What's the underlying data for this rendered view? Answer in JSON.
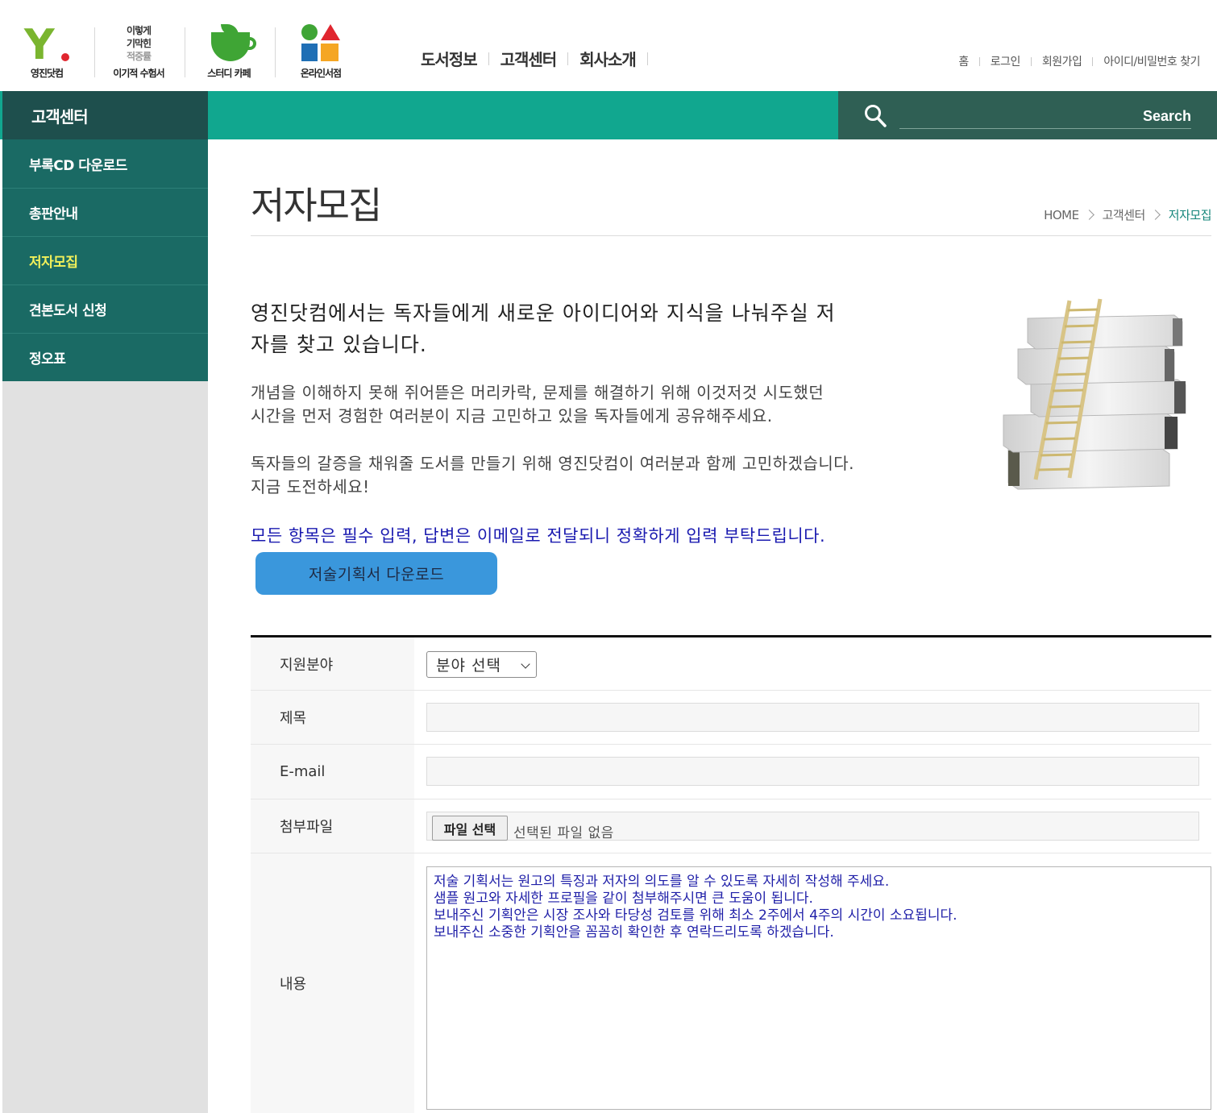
{
  "header": {
    "logos": [
      {
        "name": "영진닷컴"
      },
      {
        "name": "이기적 수험서",
        "stack": [
          "이렇게",
          "기막힌",
          "적중률"
        ]
      },
      {
        "name": "스터디 카페"
      },
      {
        "name": "온라인서점"
      }
    ],
    "gnb": [
      "도서정보",
      "고객센터",
      "회사소개"
    ],
    "util": [
      "홈",
      "로그인",
      "회원가입",
      "아이디/비밀번호 찾기"
    ]
  },
  "bar": {
    "side_title": "고객센터",
    "search_label": "Search",
    "colors": {
      "teal": "#11a78f",
      "side": "#1e4f4d",
      "search": "#2f5f54"
    }
  },
  "sidebar": {
    "items": [
      {
        "label": "부록CD 다운로드",
        "active": false
      },
      {
        "label": "총판안내",
        "active": false
      },
      {
        "label": "저자모집",
        "active": true
      },
      {
        "label": "견본도서 신청",
        "active": false
      },
      {
        "label": "정오표",
        "active": false
      }
    ]
  },
  "page": {
    "title": "저자모집",
    "breadcrumb": [
      "HOME",
      "고객센터",
      "저자모집"
    ],
    "intro_head_line1": "영진닷컴에서는 독자들에게 새로운 아이디어와 지식을 나눠주실 저",
    "intro_head_line2": "자를 찾고 있습니다.",
    "intro_p1_line1": "개념을 이해하지 못해 쥐어뜯은 머리카락, 문제를 해결하기 위해 이것저것 시도했던",
    "intro_p1_line2": "시간을 먼저 경험한 여러분이 지금 고민하고 있을 독자들에게 공유해주세요.",
    "intro_p2_line1": "독자들의 갈증을 채워줄 도서를 만들기 위해 영진닷컴이 여러분과 함께 고민하겠습니다.",
    "intro_p2_line2": "지금 도전하세요!",
    "notice": "모든 항목은 필수 입력, 답변은 이메일로 전달되니 정확하게 입력 부탁드립니다.",
    "download_button": "저술기획서 다운로드"
  },
  "form": {
    "field_label": "지원분야",
    "field_select_value": "분야 선택",
    "title_label": "제목",
    "title_value": "",
    "email_label": "E-mail",
    "email_value": "",
    "file_label": "첨부파일",
    "file_button": "파일 선택",
    "file_status": "선택된 파일 없음",
    "content_label": "내용",
    "content_lines": [
      "저술 기획서는 원고의 특징과 저자의 의도를 알 수 있도록 자세히 작성해 주세요.",
      "샘플 원고와 자세한 프로필을 같이 첨부해주시면 큰 도움이 됩니다.",
      "보내주신 기획안은 시장 조사와 타당성 검토를 위해 최소 2주에서 4주의 시간이 소요됩니다.",
      "보내주신 소중한 기획안을 꼼꼼히 확인한 후 연락드리도록 하겠습니다."
    ]
  }
}
